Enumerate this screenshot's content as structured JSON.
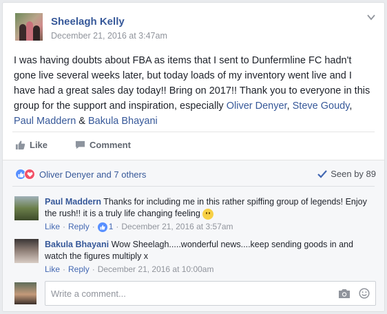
{
  "post": {
    "author": "Sheelagh Kelly",
    "timestamp": "December 21, 2016 at 3:47am",
    "text_1": "I was having doubts about FBA as items that I sent to Dunfermline FC hadn't gone live several weeks later, but today loads of my inventory went live and I have had a great sales day today!! Bring on 2017!! Thank you to everyone in this group for the support and inspiration, especially ",
    "mention_1": "Oliver Denyer",
    "sep_1": ", ",
    "mention_2": "Steve Goudy",
    "sep_2": ",",
    "mention_3": "Paul Maddern",
    "sep_3": " & ",
    "mention_4": "Bakula Bhayani"
  },
  "actions": {
    "like_label": "Like",
    "comment_label": "Comment"
  },
  "reactions": {
    "summary": "Oliver Denyer and 7 others",
    "seen_by": "Seen by 89"
  },
  "comments": [
    {
      "author": "Paul Maddern",
      "text": "Thanks for including me in this rather spiffing group of legends! Enjoy the rush!! it is a truly life changing feeling",
      "like": "Like",
      "reply": "Reply",
      "like_count": "1",
      "timestamp": "December 21, 2016 at 3:57am"
    },
    {
      "author": "Bakula Bhayani",
      "text": "Wow Sheelagh.....wonderful news....keep sending goods in and watch the figures multiply x",
      "like": "Like",
      "reply": "Reply",
      "timestamp": "December 21, 2016 at 10:00am"
    }
  ],
  "composer": {
    "placeholder": "Write a comment..."
  },
  "colors": {
    "link": "#365899",
    "like_blue": "#5890ff",
    "love_red": "#f25268",
    "meta_gray": "#90949c"
  },
  "icons": [
    "chevron-down-icon",
    "like-thumb-icon",
    "comment-bubble-icon",
    "like-reaction-icon",
    "love-reaction-icon",
    "checkmark-icon",
    "smiley-emoji-icon",
    "camera-icon",
    "emoji-icon"
  ]
}
